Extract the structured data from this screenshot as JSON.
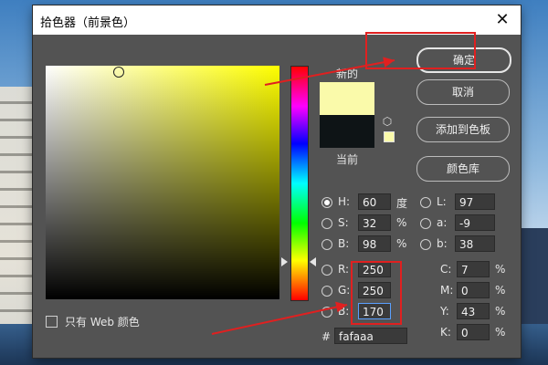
{
  "window": {
    "title": "拾色器（前景色）"
  },
  "labels": {
    "new": "新的",
    "current": "当前",
    "hash": "#"
  },
  "buttons": {
    "ok": "确定",
    "cancel": "取消",
    "add_swatch": "添加到色板",
    "libraries": "颜色库"
  },
  "websafe": {
    "label": "只有 Web 颜色"
  },
  "hsb": {
    "h": {
      "label": "H:",
      "value": "60",
      "unit": "度"
    },
    "s": {
      "label": "S:",
      "value": "32",
      "unit": "%"
    },
    "b": {
      "label": "B:",
      "value": "98",
      "unit": "%"
    }
  },
  "lab": {
    "l": {
      "label": "L:",
      "value": "97"
    },
    "a": {
      "label": "a:",
      "value": "-9"
    },
    "b": {
      "label": "b:",
      "value": "38"
    }
  },
  "rgb": {
    "r": {
      "label": "R:",
      "value": "250"
    },
    "g": {
      "label": "G:",
      "value": "250"
    },
    "b": {
      "label": "B:",
      "value": "170"
    }
  },
  "cmyk": {
    "c": {
      "label": "C:",
      "value": "7",
      "unit": "%"
    },
    "m": {
      "label": "M:",
      "value": "0",
      "unit": "%"
    },
    "y": {
      "label": "Y:",
      "value": "43",
      "unit": "%"
    },
    "k": {
      "label": "K:",
      "value": "0",
      "unit": "%"
    }
  },
  "hex": {
    "value": "fafaaa"
  },
  "colors": {
    "new": "#fafaaa",
    "current": "#0e1416",
    "annotation": "#e02020"
  },
  "icons": {
    "close": "close-icon",
    "cube": "web-safe-cube-icon"
  }
}
